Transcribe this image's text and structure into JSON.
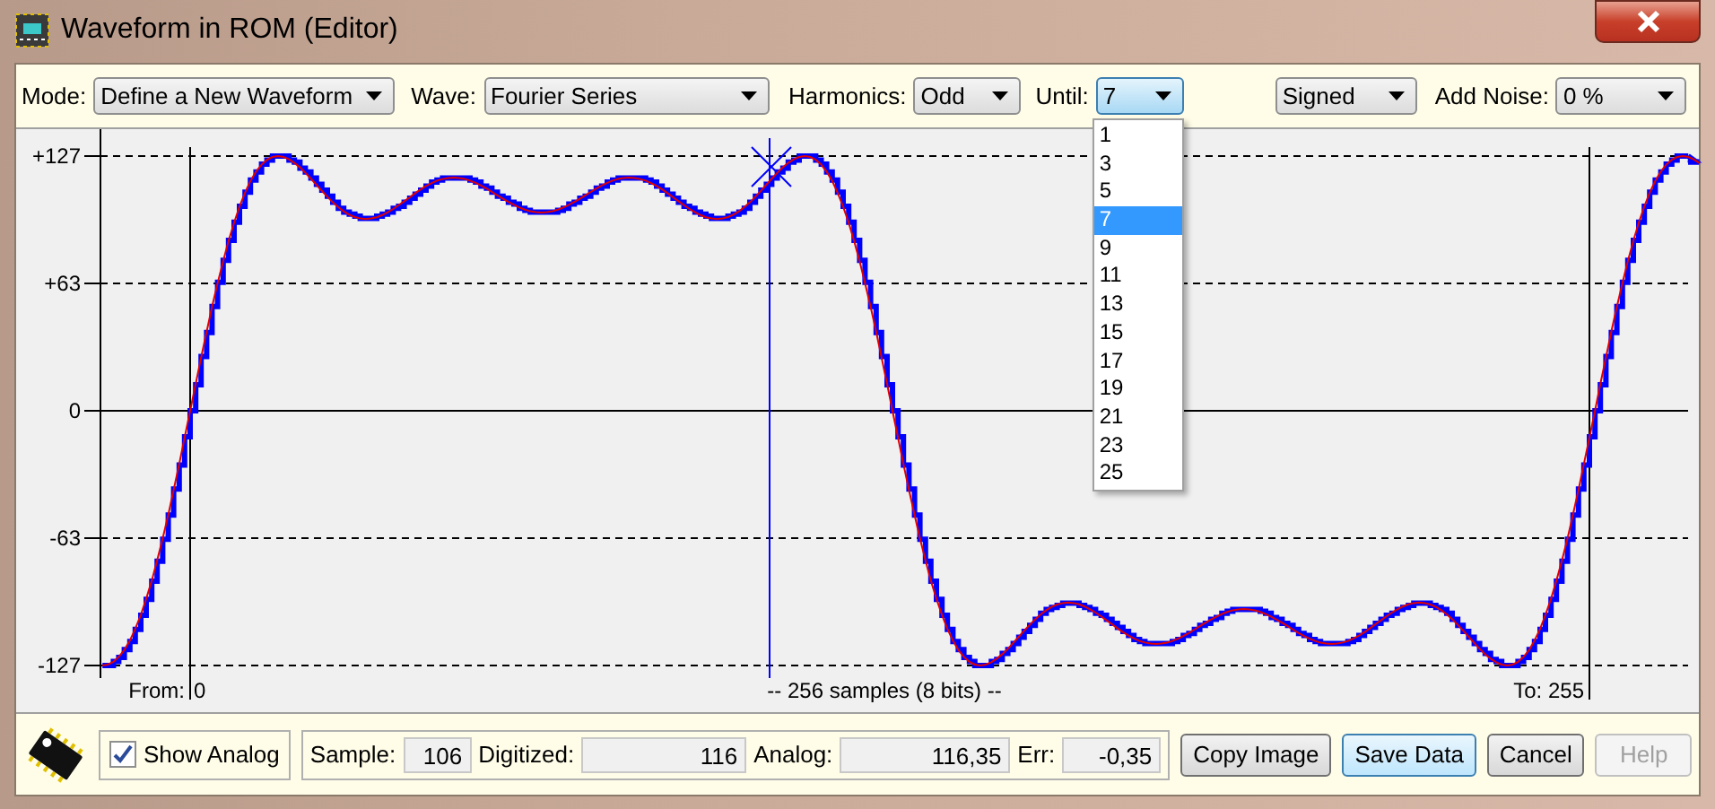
{
  "window": {
    "title": "Waveform in ROM (Editor)"
  },
  "toolbar": {
    "fields": [
      {
        "label": "Mode:",
        "value": "Define a New Waveform",
        "open": false
      },
      {
        "label": "Wave:",
        "value": "Fourier Series",
        "open": false
      },
      {
        "label": "Harmonics:",
        "value": "Odd",
        "open": false
      },
      {
        "label": "Until:",
        "value": "7",
        "open": true,
        "options": [
          {
            "label": "1",
            "selected": false
          },
          {
            "label": "3",
            "selected": false
          },
          {
            "label": "5",
            "selected": false
          },
          {
            "label": "7",
            "selected": true
          },
          {
            "label": "9",
            "selected": false
          },
          {
            "label": "11",
            "selected": false
          },
          {
            "label": "13",
            "selected": false
          },
          {
            "label": "15",
            "selected": false
          },
          {
            "label": "17",
            "selected": false
          },
          {
            "label": "19",
            "selected": false
          },
          {
            "label": "21",
            "selected": false
          },
          {
            "label": "23",
            "selected": false
          },
          {
            "label": "25",
            "selected": false
          }
        ]
      },
      {
        "value": "Signed",
        "open": false
      },
      {
        "label": "Add Noise:",
        "value": "0 %",
        "open": false
      }
    ]
  },
  "plot": {
    "y_labels": [
      "+127",
      "+63",
      "0",
      "-63",
      "-127"
    ],
    "from_label": "From:",
    "from_value": "0",
    "center_label": "-- 256 samples (8 bits) --",
    "to_label": "To: 255"
  },
  "bottom": {
    "show_analog": {
      "label": "Show Analog",
      "checked": true
    },
    "readouts": [
      {
        "label": "Sample:",
        "value": "106"
      },
      {
        "label": "Digitized:",
        "value": "116"
      },
      {
        "label": "Analog:",
        "value": "116,35"
      },
      {
        "label": "Err:",
        "value": "-0,35"
      }
    ],
    "buttons": [
      {
        "label": "Copy Image",
        "default": false,
        "disabled": false
      },
      {
        "label": "Save Data",
        "default": true,
        "disabled": false
      },
      {
        "label": "Cancel",
        "default": false,
        "disabled": false
      },
      {
        "label": "Help",
        "default": false,
        "disabled": true
      }
    ]
  }
}
